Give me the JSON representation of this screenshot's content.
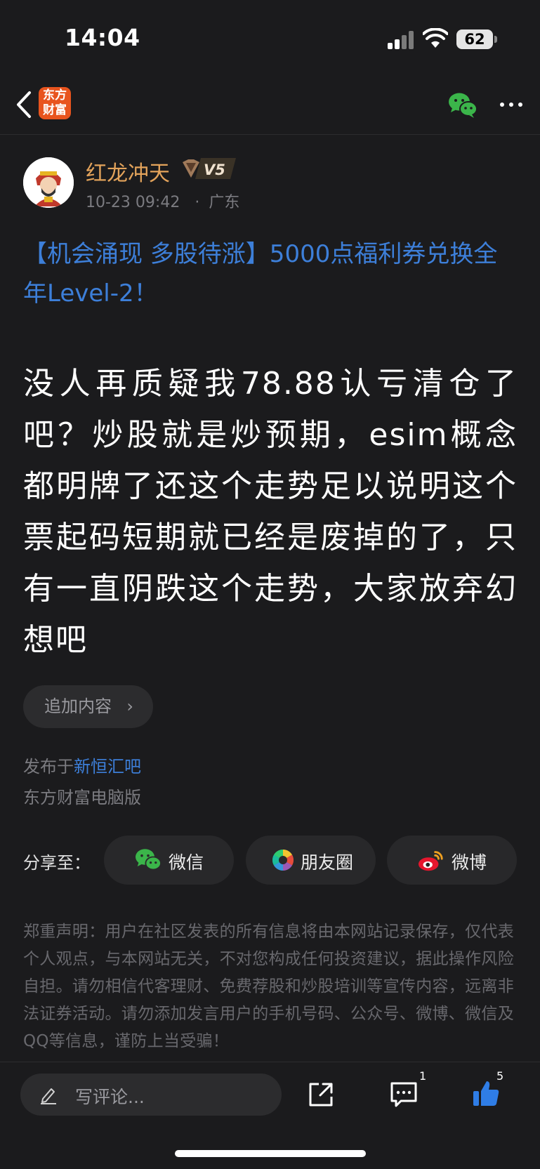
{
  "status_bar": {
    "time": "14:04",
    "battery": "62"
  },
  "nav": {
    "logo_line1": "东方",
    "logo_line2": "财富",
    "icons": [
      "back-arrow-icon",
      "wechat-icon",
      "more-dots-icon"
    ]
  },
  "author": {
    "name": "红龙冲天",
    "level": "V5",
    "date": "10-23 09:42",
    "separator": "·",
    "location": "广东"
  },
  "post": {
    "headline": "【机会涌现 多股待涨】5000点福利券兑换全年Level-2！",
    "content": "没人再质疑我78.88认亏清仓了吧？炒股就是炒预期，esim概念都明牌了还这个走势足以说明这个票起码短期就已经是废掉的了，只有一直阴跌这个走势，大家放弃幻想吧"
  },
  "append": {
    "label": "追加内容",
    "chevron": "›"
  },
  "meta": {
    "published_prefix": "发布于",
    "published_link": "新恒汇吧",
    "source": "东方财富电脑版"
  },
  "share": {
    "label": "分享至：",
    "items": [
      {
        "label": "微信",
        "icon": "wechat-icon"
      },
      {
        "label": "朋友圈",
        "icon": "moments-icon"
      },
      {
        "label": "微博",
        "icon": "weibo-icon"
      }
    ]
  },
  "disclaimer": "郑重声明：用户在社区发表的所有信息将由本网站记录保存，仅代表个人观点，与本网站无关，不对您构成任何投资建议，据此操作风险自担。请勿相信代客理财、免费荐股和炒股培训等宣传内容，远离非法证券活动。请勿添加发言用户的手机号码、公众号、微博、微信及QQ等信息，谨防上当受骗！",
  "bottom": {
    "comment_placeholder": "写评论...",
    "comment_count": "1",
    "like_count": "5"
  },
  "colors": {
    "background": "#1b1b1d",
    "link_blue": "#3d7fd9",
    "author_gold": "#e3a35b",
    "like_blue": "#2f7de6",
    "wechat_green": "#3bb54a",
    "logo_orange": "#e8541e"
  }
}
